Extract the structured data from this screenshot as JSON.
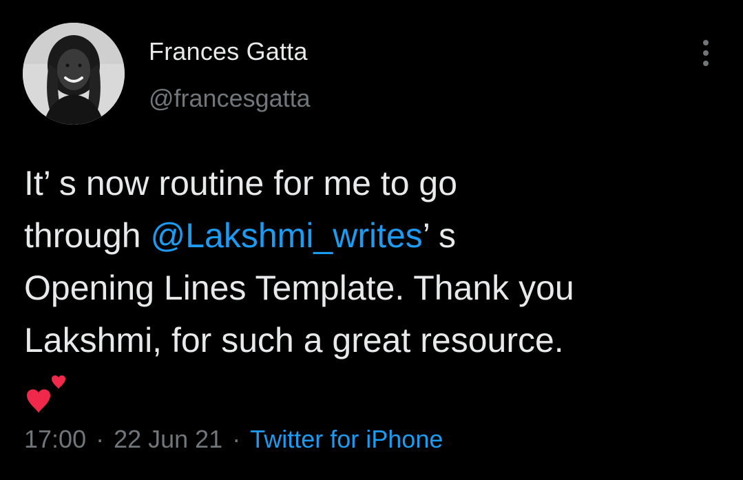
{
  "author": {
    "display_name": "Frances Gatta",
    "handle": "@francesgatta"
  },
  "tweet": {
    "line1": "It’ s now routine for me to go",
    "line2_prefix": "through ",
    "mention": "@Lakshmi_writes",
    "line2_suffix": "’ s",
    "line3": "Opening Lines Template. Thank you",
    "line4": "Lakshmi, for such a great resource.",
    "emoji": "two-hearts-emoji"
  },
  "meta": {
    "time": "17:00",
    "separator": "·",
    "date": "22 Jun 21",
    "source": "Twitter for iPhone"
  },
  "icons": {
    "more": "more-vertical-icon",
    "avatar": "avatar-photo"
  },
  "colors": {
    "background": "#000000",
    "text": "#e7e9ea",
    "secondary": "#71767b",
    "accent": "#1d9bf0",
    "heart": "#f0284a"
  }
}
